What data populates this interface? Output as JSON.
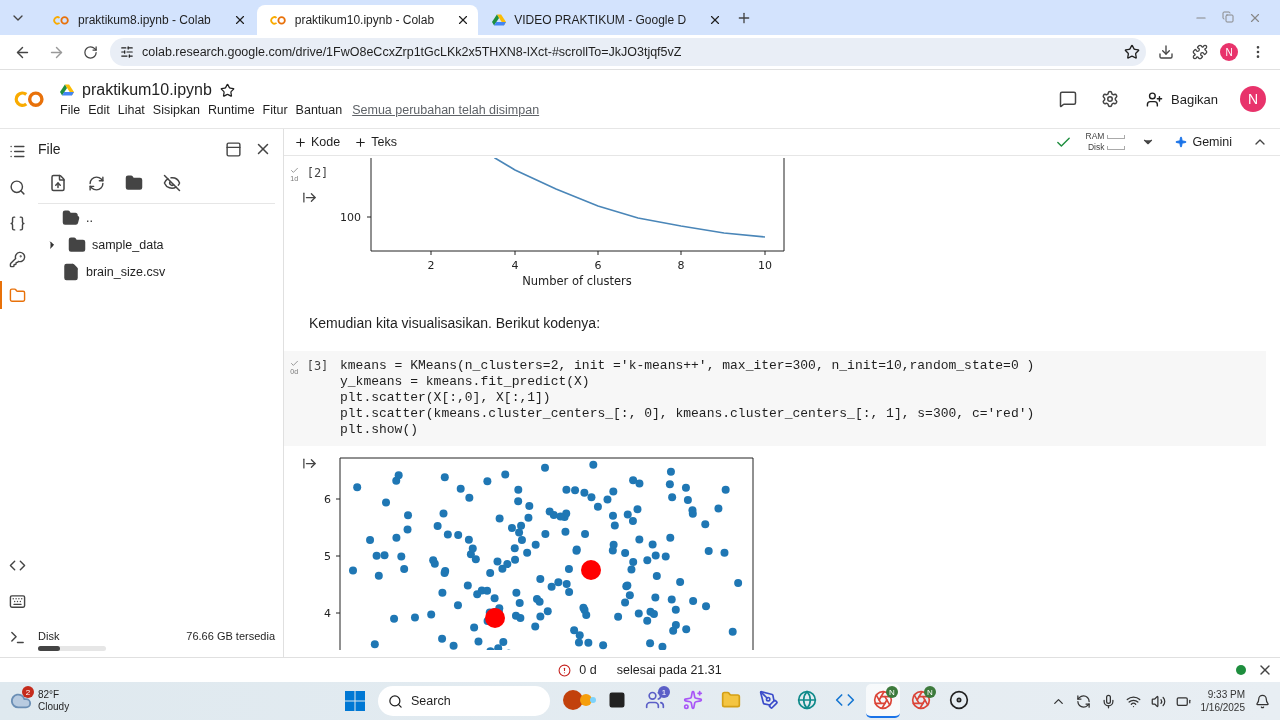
{
  "browser": {
    "tabs": [
      {
        "label": "praktikum8.ipynb - Colab",
        "kind": "colab",
        "selected": false
      },
      {
        "label": "praktikum10.ipynb - Colab",
        "kind": "colab",
        "selected": true
      },
      {
        "label": "VIDEO PRAKTIKUM - Google D",
        "kind": "drive",
        "selected": false
      }
    ],
    "url": "colab.research.google.com/drive/1FwO8eCcxZrp1tGcLKk2x5THXN8-lXct-#scrollTo=JkJO3tjqf5vZ",
    "profile_initial": "N"
  },
  "notebook": {
    "title": "praktikum10.ipynb",
    "menu": [
      "File",
      "Edit",
      "Lihat",
      "Sisipkan",
      "Runtime",
      "Fitur",
      "Bantuan"
    ],
    "save_status": "Semua perubahan telah disimpan",
    "share_label": "Bagikan",
    "avatar_initial": "N"
  },
  "toolbar": {
    "add_buttons": [
      "Kode",
      "Teks"
    ],
    "ram_label": "RAM",
    "disk_label": "Disk",
    "gemini_label": "Gemini"
  },
  "sidebar": {
    "title": "File",
    "rail": [
      {
        "kind": "toc",
        "selected": false
      },
      {
        "kind": "search",
        "selected": false
      },
      {
        "kind": "variables",
        "selected": false
      },
      {
        "kind": "secrets",
        "selected": false
      },
      {
        "kind": "files",
        "selected": true
      }
    ],
    "rail_bottom": [
      {
        "kind": "code"
      },
      {
        "kind": "commands"
      },
      {
        "kind": "terminal"
      }
    ],
    "tree": [
      {
        "name": "..",
        "kind": "parent"
      },
      {
        "name": "sample_data",
        "kind": "folder",
        "expanded": false
      },
      {
        "name": "brain_size.csv",
        "kind": "file"
      }
    ],
    "disk": {
      "label": "Disk",
      "free": "76.66 GB tersedia",
      "level": 0.33
    }
  },
  "cells": [
    {
      "kind": "output",
      "prompt": "[2]",
      "duration": "1d",
      "chart": {
        "kind": "line",
        "x_ticks": [
          "2",
          "4",
          "6",
          "8",
          "10"
        ],
        "y_ticks": [
          "100"
        ],
        "xlabel": "Number of clusters"
      }
    },
    {
      "kind": "text",
      "text": "Kemudian kita visualisasikan. Berikut kodenya:"
    },
    {
      "kind": "code",
      "prompt": "[3]",
      "duration": "0d",
      "lines": [
        "kmeans = KMeans(n_clusters=2, init ='k-means++', max_iter=300, n_init=10,random_state=0 )",
        "y_kmeans = kmeans.fit_predict(X)",
        "plt.scatter(X[:,0], X[:,1])",
        "plt.scatter(kmeans.cluster_centers_[:, 0], kmeans.cluster_centers_[:, 1], s=300, c='red')",
        "plt.show()"
      ],
      "chart": {
        "kind": "scatter",
        "y_ticks": [
          "6",
          "5",
          "4"
        ]
      }
    }
  ],
  "status_bar": {
    "duration": "0 d",
    "message": "selesai pada 21.31",
    "connected": true
  },
  "taskbar": {
    "weather": {
      "temp": "82°F",
      "condition": "Cloudy",
      "badge": "2"
    },
    "search_placeholder": "Search",
    "apps": [
      {
        "kind": "media",
        "active": false
      },
      {
        "kind": "taskview",
        "active": false
      },
      {
        "kind": "teams",
        "active": false,
        "badge": "1"
      },
      {
        "kind": "copilot",
        "active": false
      },
      {
        "kind": "explorer",
        "active": false
      },
      {
        "kind": "pen",
        "active": false
      },
      {
        "kind": "edge",
        "active": false
      },
      {
        "kind": "vscode",
        "active": false
      },
      {
        "kind": "chrome",
        "active": true,
        "badge": "N"
      },
      {
        "kind": "chrome",
        "active": false,
        "badge": "N"
      },
      {
        "kind": "obs",
        "active": false
      }
    ],
    "time": "9:33 PM",
    "date": "1/16/2025"
  }
}
